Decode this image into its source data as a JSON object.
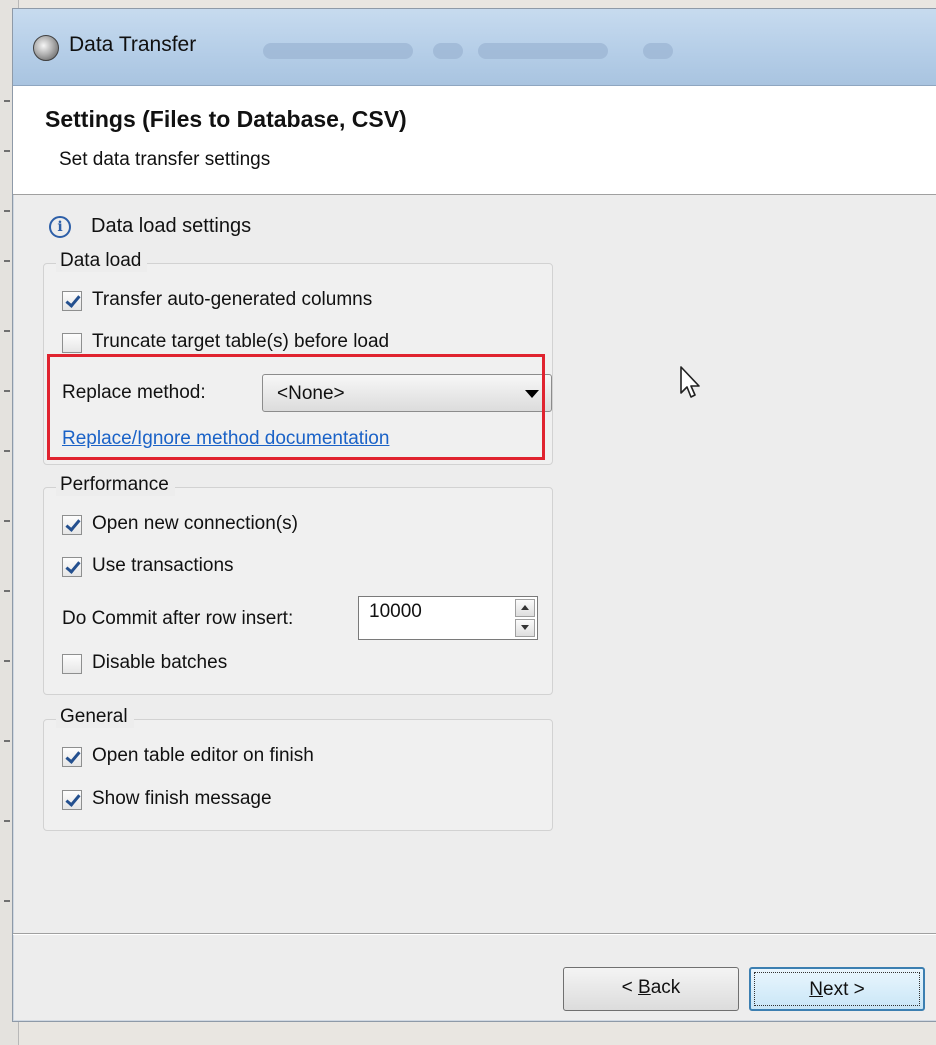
{
  "window": {
    "title": "Data Transfer"
  },
  "header": {
    "title": "Settings (Files to Database, CSV)",
    "subtitle": "Set data transfer settings"
  },
  "info": {
    "icon": "info-icon",
    "label": "Data load settings"
  },
  "data_load": {
    "legend": "Data load",
    "transfer_auto_generated": {
      "label": "Transfer auto-generated columns",
      "checked": true
    },
    "truncate_target": {
      "label": "Truncate target table(s) before load",
      "checked": false
    },
    "replace_method_label": "Replace method:",
    "replace_method_value": "<None>",
    "doc_link": "Replace/Ignore method documentation",
    "highlight_color": "#e0232f"
  },
  "performance": {
    "legend": "Performance",
    "open_new_connection": {
      "label": "Open new connection(s)",
      "checked": true
    },
    "use_transactions": {
      "label": "Use transactions",
      "checked": true
    },
    "commit_label": "Do Commit after row insert:",
    "commit_value": "10000",
    "disable_batches": {
      "label": "Disable batches",
      "checked": false
    }
  },
  "general": {
    "legend": "General",
    "open_table_editor": {
      "label": "Open table editor on finish",
      "checked": true
    },
    "show_finish_message": {
      "label": "Show finish message",
      "checked": true
    }
  },
  "buttons": {
    "back_prefix": "< ",
    "back_mnemonic": "B",
    "back_rest": "ack",
    "next_mnemonic": "N",
    "next_rest": "ext >"
  },
  "colors": {
    "link": "#1a62c7",
    "checkmark": "#24508f"
  }
}
